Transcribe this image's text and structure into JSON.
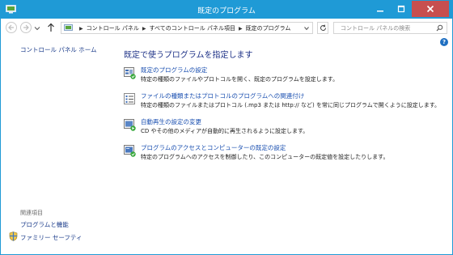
{
  "window": {
    "title": "既定のプログラム"
  },
  "colors": {
    "titlebar": "#1f9ad6",
    "link": "#1a4fb0",
    "heading": "#1e3287",
    "close": "#c74f4f"
  },
  "address": {
    "crumbs": [
      "コントロール パネル",
      "すべてのコントロール パネル項目",
      "既定のプログラム"
    ]
  },
  "search": {
    "placeholder": "コントロール パネルの検索"
  },
  "help_label": "?",
  "sidebar": {
    "home_link": "コントロール パネル ホーム",
    "see_also_heading": "関連項目",
    "related": [
      "プログラムと機能",
      "ファミリー セーフティ"
    ]
  },
  "main": {
    "heading": "既定で使うプログラムを指定します",
    "tasks": [
      {
        "link": "既定のプログラムの設定",
        "desc": "特定の種類のファイルやプロトコルを開く、既定のプログラムを設定します。",
        "icon": "default-programs-icon"
      },
      {
        "link": "ファイルの種類またはプロトコルのプログラムへの関連付け",
        "desc": "特定の種類のファイルまたはプロトコル (.mp3 または http:// など) を常に同じプログラムで開くように設定します。",
        "icon": "file-association-icon"
      },
      {
        "link": "自動再生の設定の変更",
        "desc": "CD やその他のメディアが自動的に再生されるように設定します。",
        "icon": "autoplay-icon"
      },
      {
        "link": "プログラムのアクセスとコンピューターの既定の設定",
        "desc": "特定のプログラムへのアクセスを制御したり、このコンピューターの既定値を設定したりします。",
        "icon": "program-access-icon"
      }
    ]
  }
}
